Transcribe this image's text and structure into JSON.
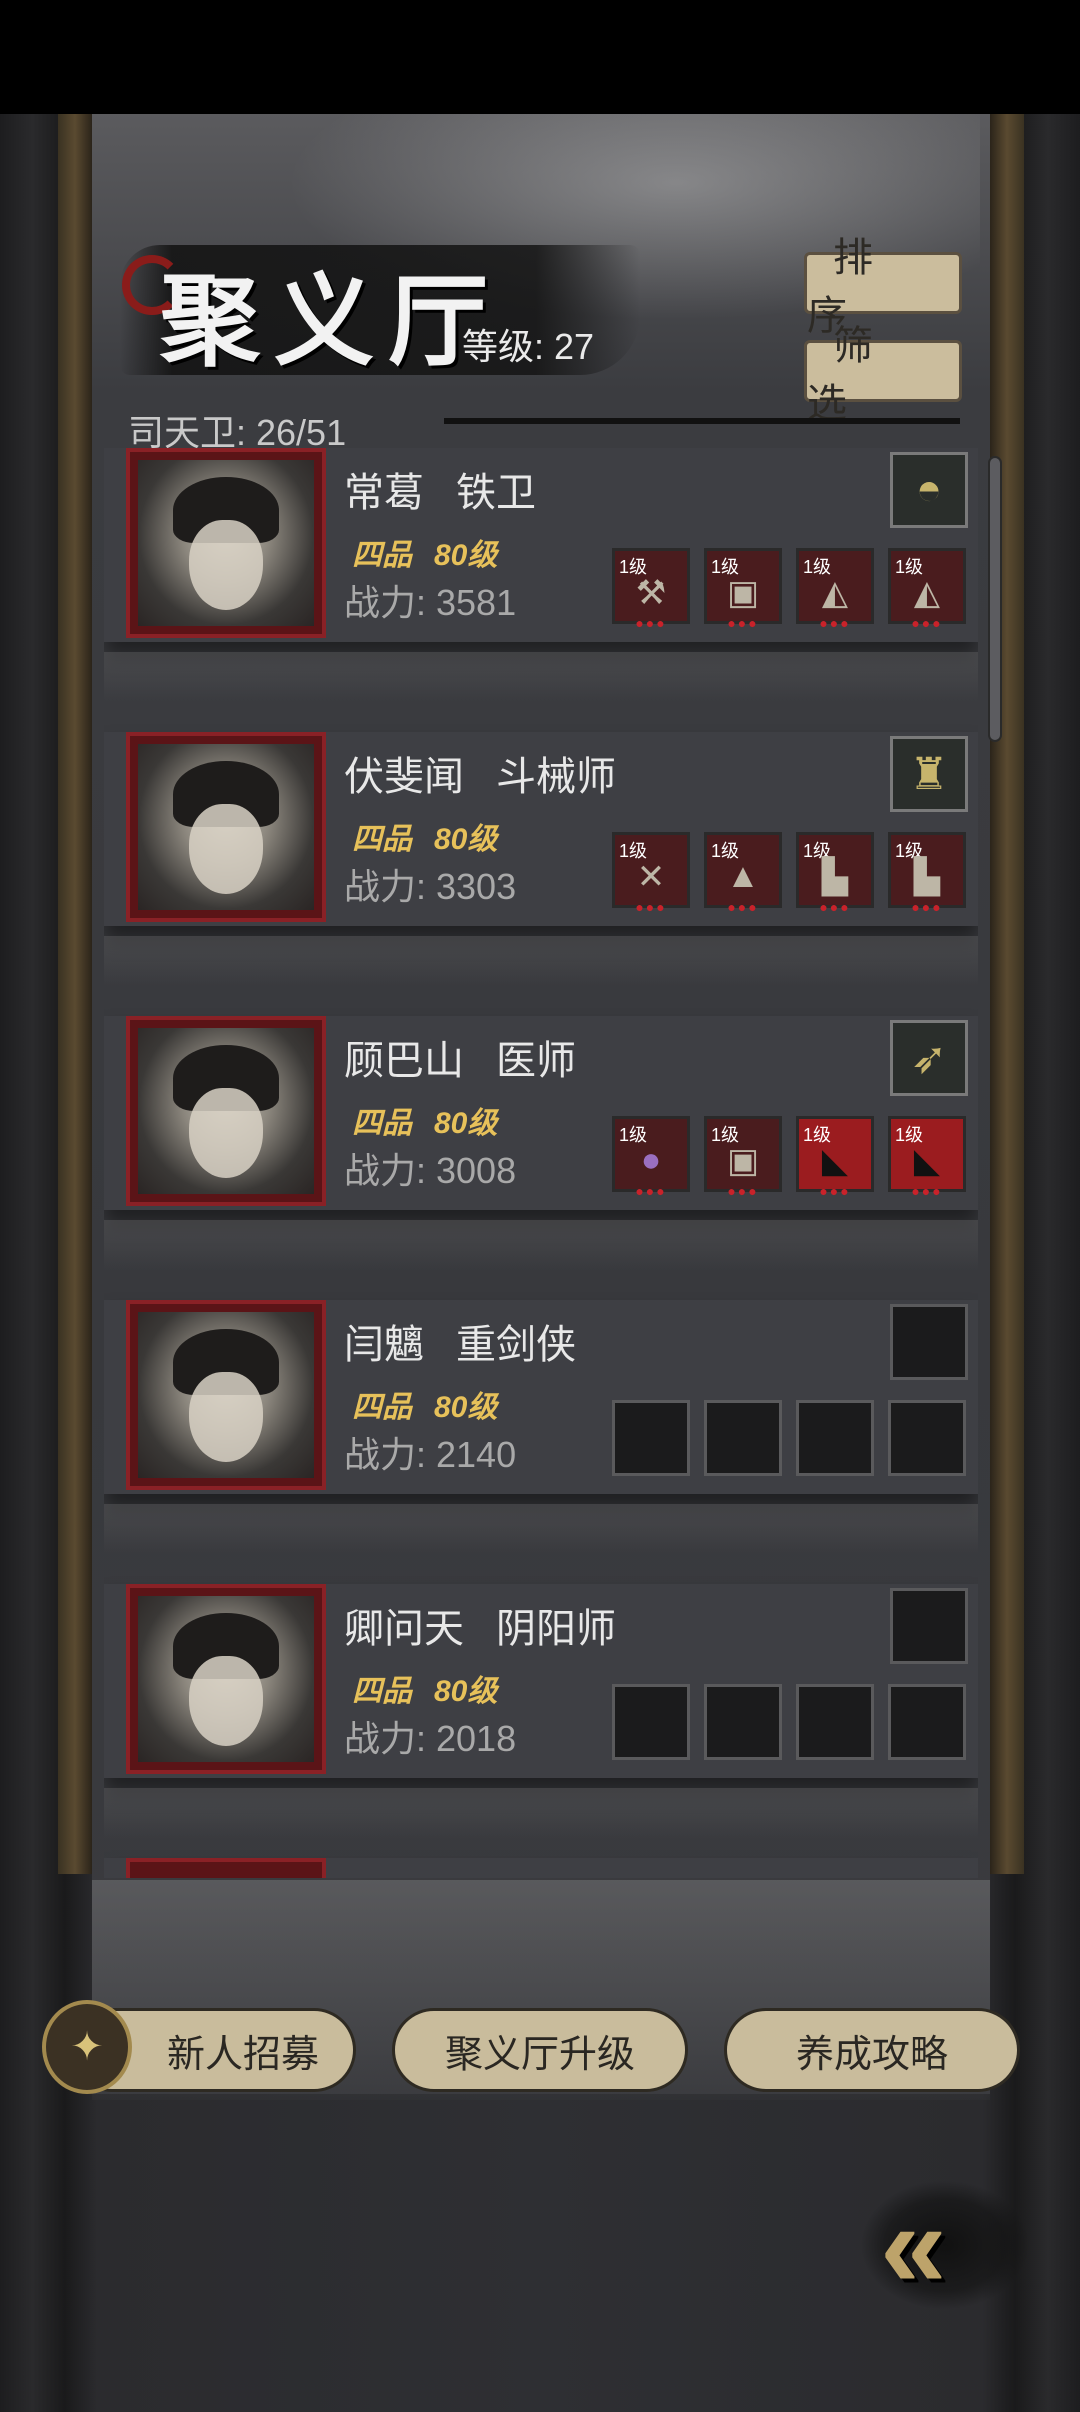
{
  "header": {
    "title": "聚义厅",
    "level_label": "等级: 27",
    "sort_button": "排序",
    "filter_button": "筛选",
    "guard_count": "司天卫: 26/51"
  },
  "heroes": [
    {
      "name": "常葛",
      "role": "铁卫",
      "grade": "四品",
      "level": "80级",
      "power": "战力: 3581",
      "treasure": "bowl-treasure-icon",
      "gear": [
        {
          "level": "1级",
          "icon": "hammer-icon"
        },
        {
          "level": "1级",
          "icon": "armor-icon"
        },
        {
          "level": "1级",
          "icon": "gauntlet-icon"
        },
        {
          "level": "1级",
          "icon": "gauntlet-icon"
        }
      ]
    },
    {
      "name": "伏斐闻",
      "role": "斗械师",
      "grade": "四品",
      "level": "80级",
      "power": "战力: 3303",
      "treasure": "golden-idol-icon",
      "gear": [
        {
          "level": "1级",
          "icon": "crossbow-icon"
        },
        {
          "level": "1级",
          "icon": "cloak-icon"
        },
        {
          "level": "1级",
          "icon": "boots-icon"
        },
        {
          "level": "1级",
          "icon": "boots-icon"
        }
      ]
    },
    {
      "name": "顾巴山",
      "role": "医师",
      "grade": "四品",
      "level": "80级",
      "power": "战力: 3008",
      "treasure": "feather-treasure-icon",
      "gear": [
        {
          "level": "1级",
          "icon": "gourd-icon"
        },
        {
          "level": "1级",
          "icon": "armor-icon"
        },
        {
          "level": "1级",
          "icon": "red-scroll-icon"
        },
        {
          "level": "1级",
          "icon": "red-scroll-icon"
        }
      ]
    },
    {
      "name": "闫魑",
      "role": "重剑侠",
      "grade": "四品",
      "level": "80级",
      "power": "战力: 2140",
      "treasure": "",
      "gear": []
    },
    {
      "name": "卿问天",
      "role": "阴阳师",
      "grade": "四品",
      "level": "80级",
      "power": "战力: 2018",
      "treasure": "",
      "gear": []
    }
  ],
  "bottom": {
    "recruit": "新人招募",
    "upgrade": "聚义厅升级",
    "guide": "养成攻略"
  },
  "colors": {
    "accent_gold": "#e7c15a",
    "button_beige": "#c9bc9c",
    "portrait_red": "#8a2126"
  }
}
